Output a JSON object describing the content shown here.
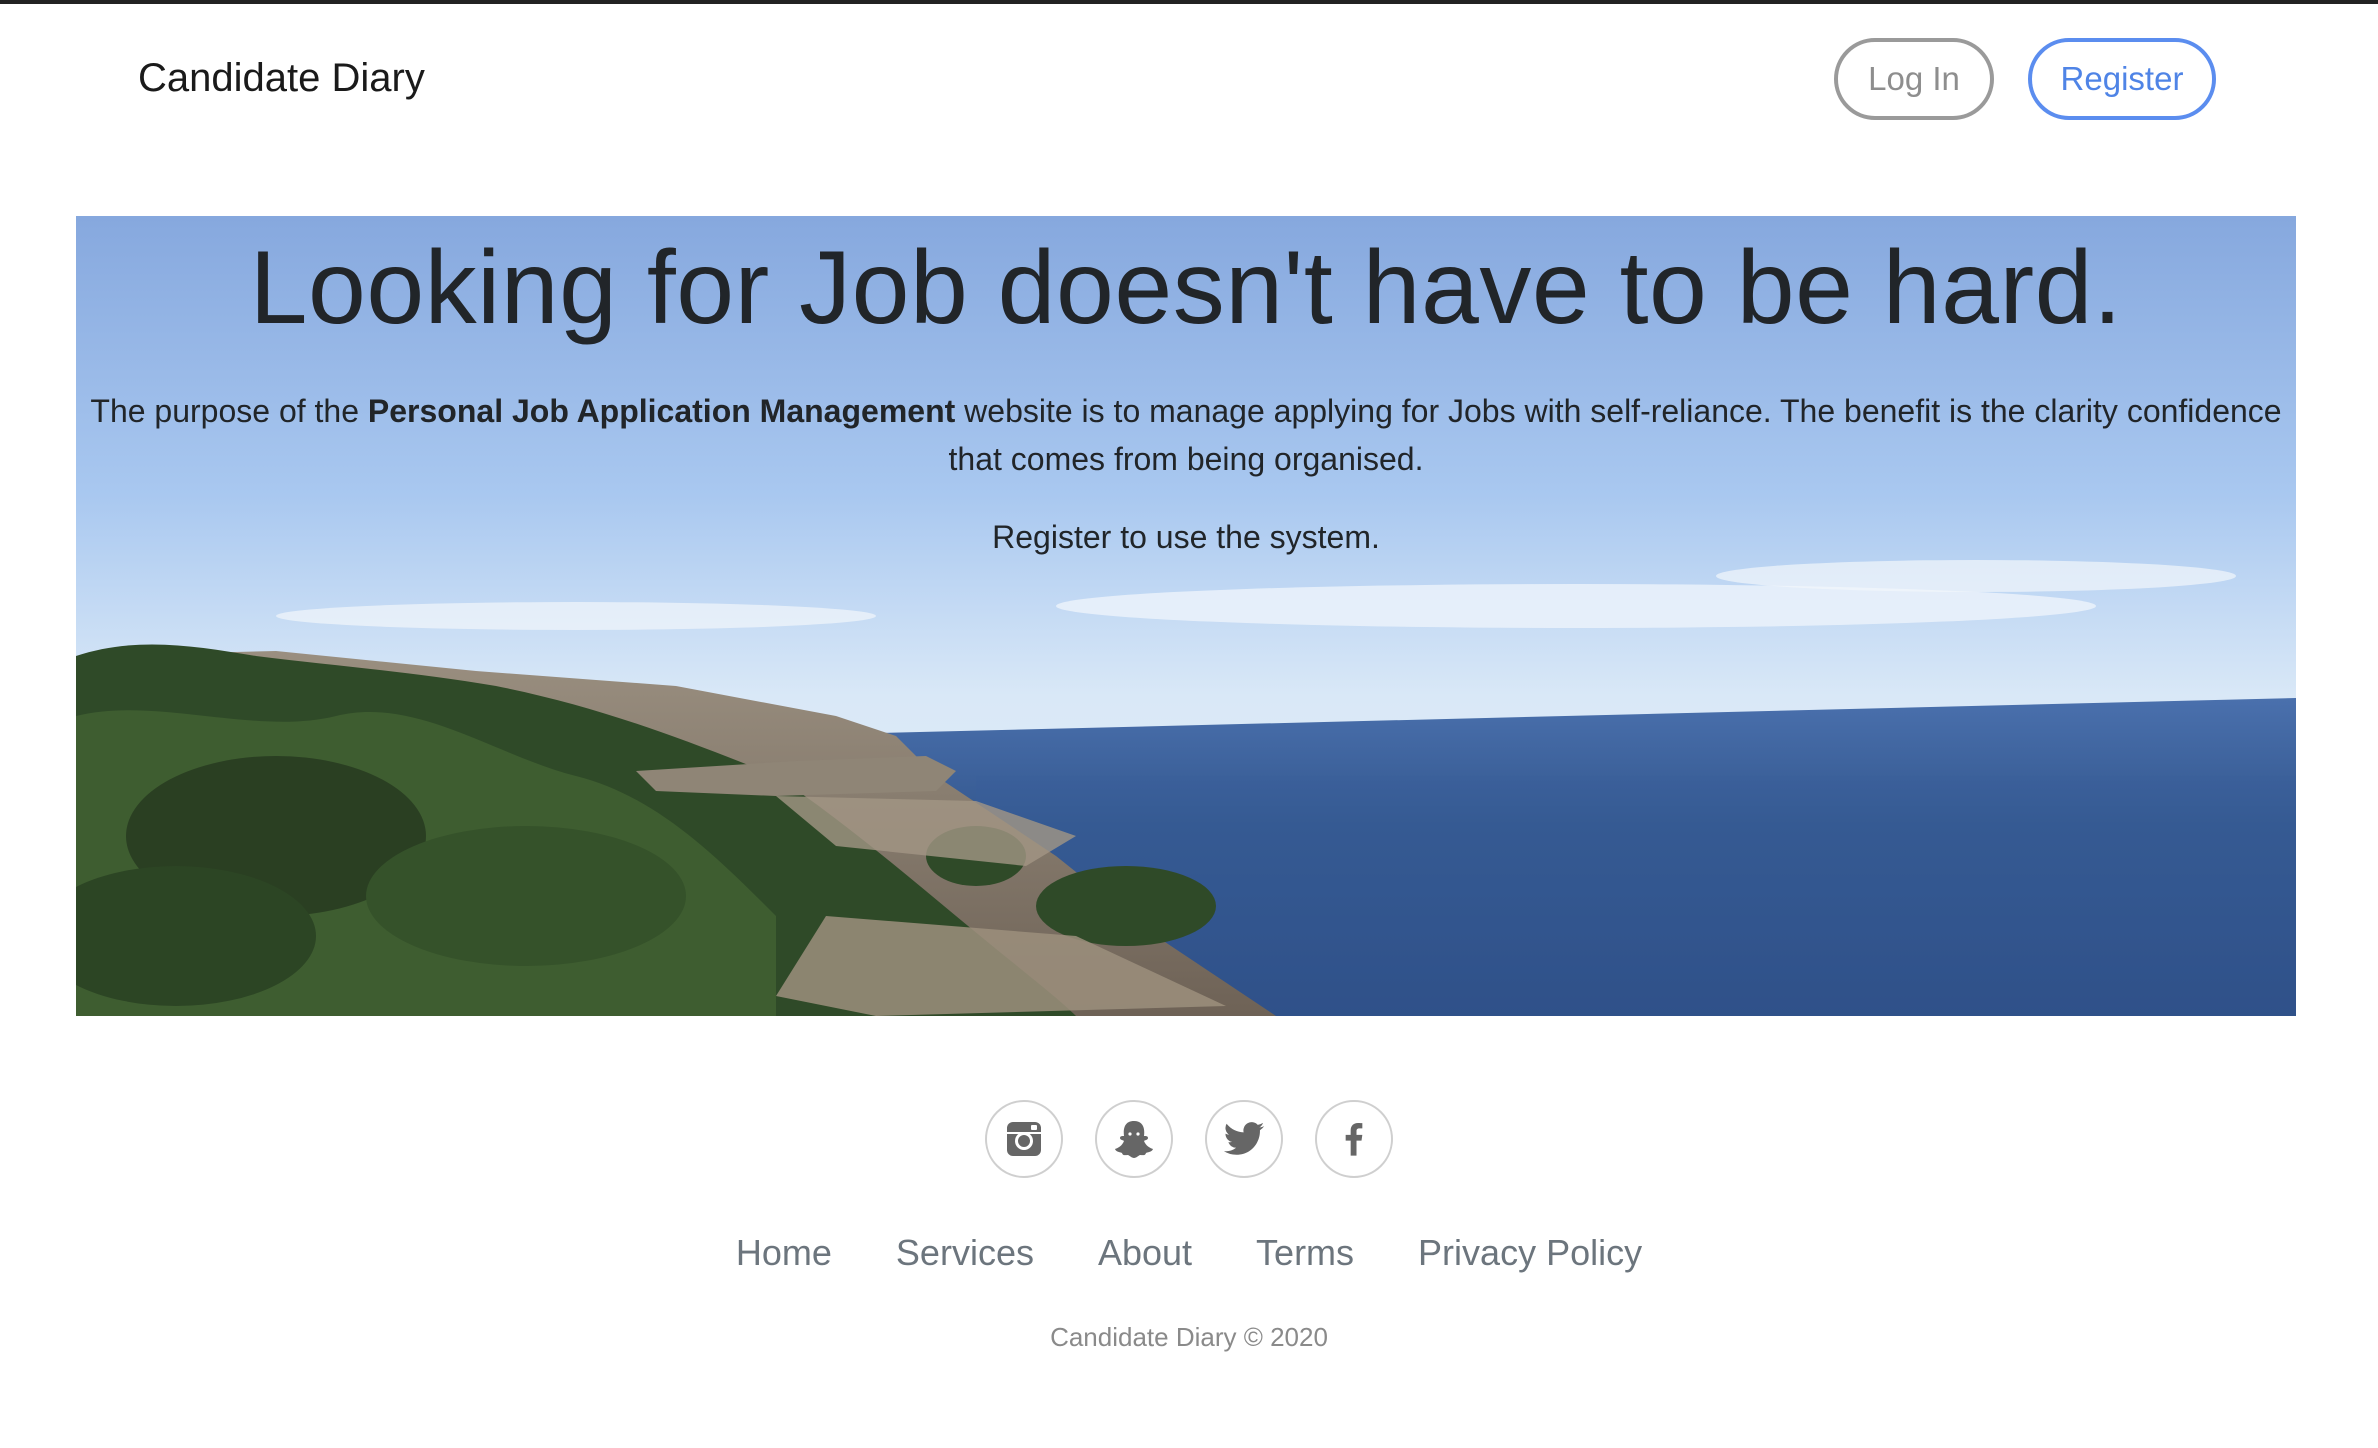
{
  "header": {
    "brand": "Candidate Diary",
    "login_label": "Log In",
    "register_label": "Register"
  },
  "hero": {
    "title": "Looking for Job doesn't have to be hard.",
    "desc_prefix": "The purpose of the ",
    "desc_bold": "Personal Job Application Management",
    "desc_suffix": " website is to manage applying for Jobs with self-reliance. The benefit is the clarity confidence that comes from being organised.",
    "cta": "Register to use the system."
  },
  "social": [
    {
      "icon": "instagram-icon"
    },
    {
      "icon": "snapchat-icon"
    },
    {
      "icon": "twitter-icon"
    },
    {
      "icon": "facebook-icon"
    }
  ],
  "footer": {
    "links": [
      "Home",
      "Services",
      "About",
      "Terms",
      "Privacy Policy"
    ],
    "copyright": "Candidate Diary © 2020"
  },
  "colors": {
    "accent": "#4f84e6",
    "muted": "#6c757d",
    "text": "#212529"
  }
}
